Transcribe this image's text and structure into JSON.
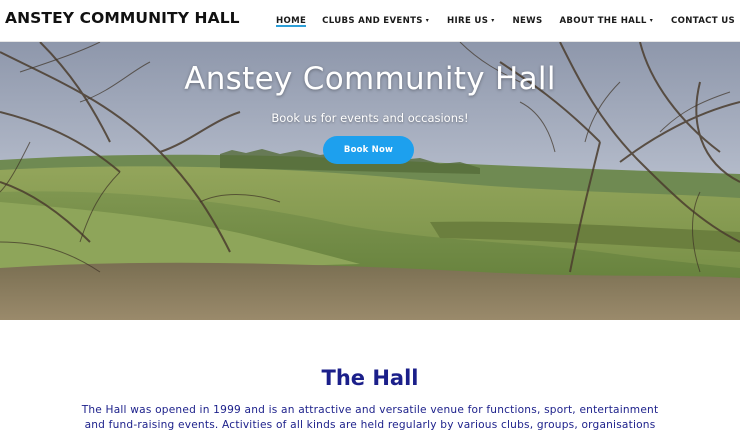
{
  "site": {
    "title": "ANSTEY COMMUNITY HALL"
  },
  "nav": {
    "items": [
      {
        "label": "HOME",
        "active": true,
        "dropdown": false
      },
      {
        "label": "CLUBS AND EVENTS",
        "active": false,
        "dropdown": true
      },
      {
        "label": "HIRE US",
        "active": false,
        "dropdown": true
      },
      {
        "label": "NEWS",
        "active": false,
        "dropdown": false
      },
      {
        "label": "ABOUT THE HALL",
        "active": false,
        "dropdown": true
      },
      {
        "label": "CONTACT US",
        "active": false,
        "dropdown": false
      }
    ],
    "active_color": "#2d9fd8"
  },
  "hero": {
    "title": "Anstey Community Hall",
    "subtitle": "Book us for events and occasions!",
    "button_label": "Book Now",
    "button_color": "#1da0ee"
  },
  "section": {
    "title": "The Hall",
    "body": "The Hall was opened in 1999 and is an attractive and versatile venue for functions, sport, entertainment and fund-raising events. Activities of all kinds are held regularly by various clubs, groups, organisations",
    "text_color": "#1b1f8a"
  }
}
